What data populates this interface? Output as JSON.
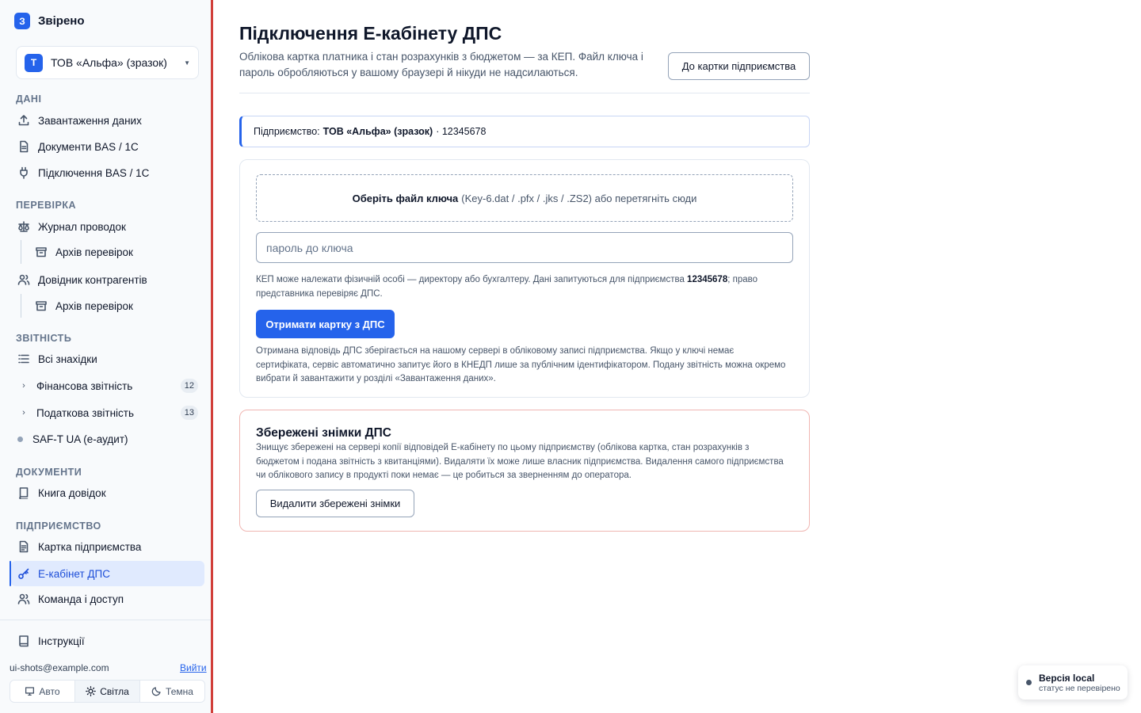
{
  "brand": {
    "logo_letter": "З",
    "name": "Звірено"
  },
  "org": {
    "avatar_letter": "Т",
    "name": "ТОВ «Альфа» (зразок)"
  },
  "sidebar": {
    "sections": {
      "data": "ДАНІ",
      "check": "ПЕРЕВІРКА",
      "reports": "ЗВІТНІСТЬ",
      "documents": "ДОКУМЕНТИ",
      "company": "ПІДПРИЄМСТВО"
    },
    "items": {
      "upload": "Завантаження даних",
      "bas_docs": "Документи BAS / 1С",
      "bas_connect": "Підключення BAS / 1С",
      "journal": "Журнал проводок",
      "journal_archive": "Архів перевірок",
      "counterparties": "Довідник контрагентів",
      "counterparties_archive": "Архів перевірок",
      "all_findings": "Всі знахідки",
      "financial": "Фінансова звітність",
      "financial_count": "12",
      "tax": "Податкова звітність",
      "tax_count": "13",
      "saft": "SAF-T UA (е-аудит)",
      "book": "Книга довідок",
      "company_card": "Картка підприємства",
      "ecabinet": "Е-кабінет ДПС",
      "team": "Команда і доступ",
      "instructions": "Інструкції"
    },
    "user_email": "ui-shots@example.com",
    "logout": "Вийти",
    "theme": {
      "auto": "Авто",
      "light": "Світла",
      "dark": "Темна",
      "selected": "Світла"
    }
  },
  "main": {
    "title": "Підключення Е-кабінету ДПС",
    "subtitle": "Облікова картка платника і стан розрахунків з бюджетом — за КЕП. Файл ключа і пароль обробляються у вашому браузері й нікуди не надсилаються.",
    "to_card_button": "До картки підприємства",
    "company_bar": {
      "label": "Підприємство:",
      "name": "ТОВ «Альфа» (зразок)",
      "code": "· 12345678"
    },
    "key_card": {
      "dropzone_bold": "Оберіть файл ключа",
      "dropzone_rest": "(Key-6.dat / .pfx / .jks / .ZS2) або перетягніть сюди",
      "password_placeholder": "пароль до ключа",
      "password_value": "",
      "hint_before": "КЕП може належати фізичній особі — директору або бухгалтеру. Дані запитуються для підприємства",
      "hint_code": "12345678",
      "hint_after": "; право представника перевіряє ДПС.",
      "submit_button": "Отримати картку з ДПС",
      "footnote": "Отримана відповідь ДПС зберігається на нашому сервері в обліковому записі підприємства. Якщо у ключі немає сертифіката, сервіс автоматично запитує його в КНЕДП лише за публічним ідентифікатором. Подану звітність можна окремо вибрати й завантажити у розділі «Завантаження даних»."
    },
    "snapshots": {
      "title": "Збережені знімки ДПС",
      "text": "Знищує збережені на сервері копії відповідей Е-кабінету по цьому підприємству (облікова картка, стан розрахунків з бюджетом і подана звітність з квитанціями). Видаляти їх може лише власник підприємства. Видалення самого підприємства чи облікового запису в продукті поки немає — це робиться за зверненням до оператора.",
      "delete_button": "Видалити збережені знімки"
    }
  },
  "toast": {
    "title": "Версія local",
    "subtitle": "статус не перевірено"
  },
  "colors": {
    "accent": "#2563eb",
    "divider": "#d13f3a",
    "danger_border": "#f0b6b2"
  },
  "icons": [
    "upload-icon",
    "document-icon",
    "plug-icon",
    "scales-icon",
    "archive-icon",
    "users-icon",
    "list-icon",
    "chevron-right-icon",
    "book-icon",
    "file-text-icon",
    "key-icon",
    "team-icon",
    "book-open-icon",
    "monitor-icon",
    "sun-icon",
    "moon-icon"
  ]
}
